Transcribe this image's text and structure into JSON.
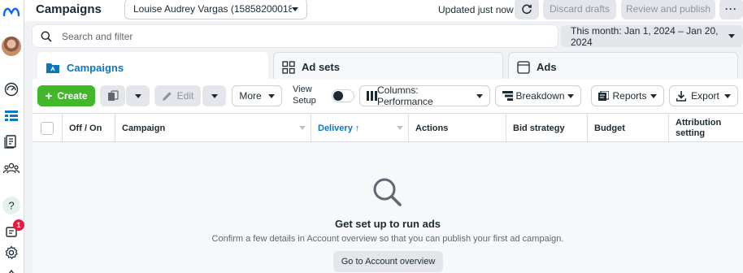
{
  "header": {
    "title": "Campaigns",
    "account_select": "Louise Audrey Vargas (158582000185…",
    "updated_text": "Updated just now",
    "discard_label": "Discard drafts",
    "review_label": "Review and publish",
    "more_label": "···"
  },
  "search": {
    "placeholder": "Search and filter"
  },
  "date_range": {
    "label": "This month: Jan 1, 2024 – Jan 20, 2024"
  },
  "tabs": [
    {
      "label": "Campaigns",
      "icon": "campaigns-folder-icon",
      "active": true
    },
    {
      "label": "Ad sets",
      "icon": "grid-icon",
      "active": false
    },
    {
      "label": "Ads",
      "icon": "ad-frame-icon",
      "active": false
    }
  ],
  "toolbar": {
    "create_label": "Create",
    "edit_label": "Edit",
    "more_label": "More",
    "view_setup_label": "View Setup",
    "columns_label": "Columns: Performance",
    "breakdown_label": "Breakdown",
    "reports_label": "Reports",
    "export_label": "Export"
  },
  "table": {
    "columns": [
      "Off / On",
      "Campaign",
      "Delivery ↑",
      "Actions",
      "Bid strategy",
      "Budget",
      "Attribution setting"
    ]
  },
  "empty_state": {
    "title": "Get set up to run ads",
    "description": "Confirm a few details in Account overview so that you can publish your first ad campaign.",
    "button_label": "Go to Account overview"
  },
  "sidebar": {
    "notification_count": "1"
  },
  "colors": {
    "primary_blue": "#0a78be",
    "create_green": "#42b72a",
    "badge_red": "#e41e3f"
  }
}
